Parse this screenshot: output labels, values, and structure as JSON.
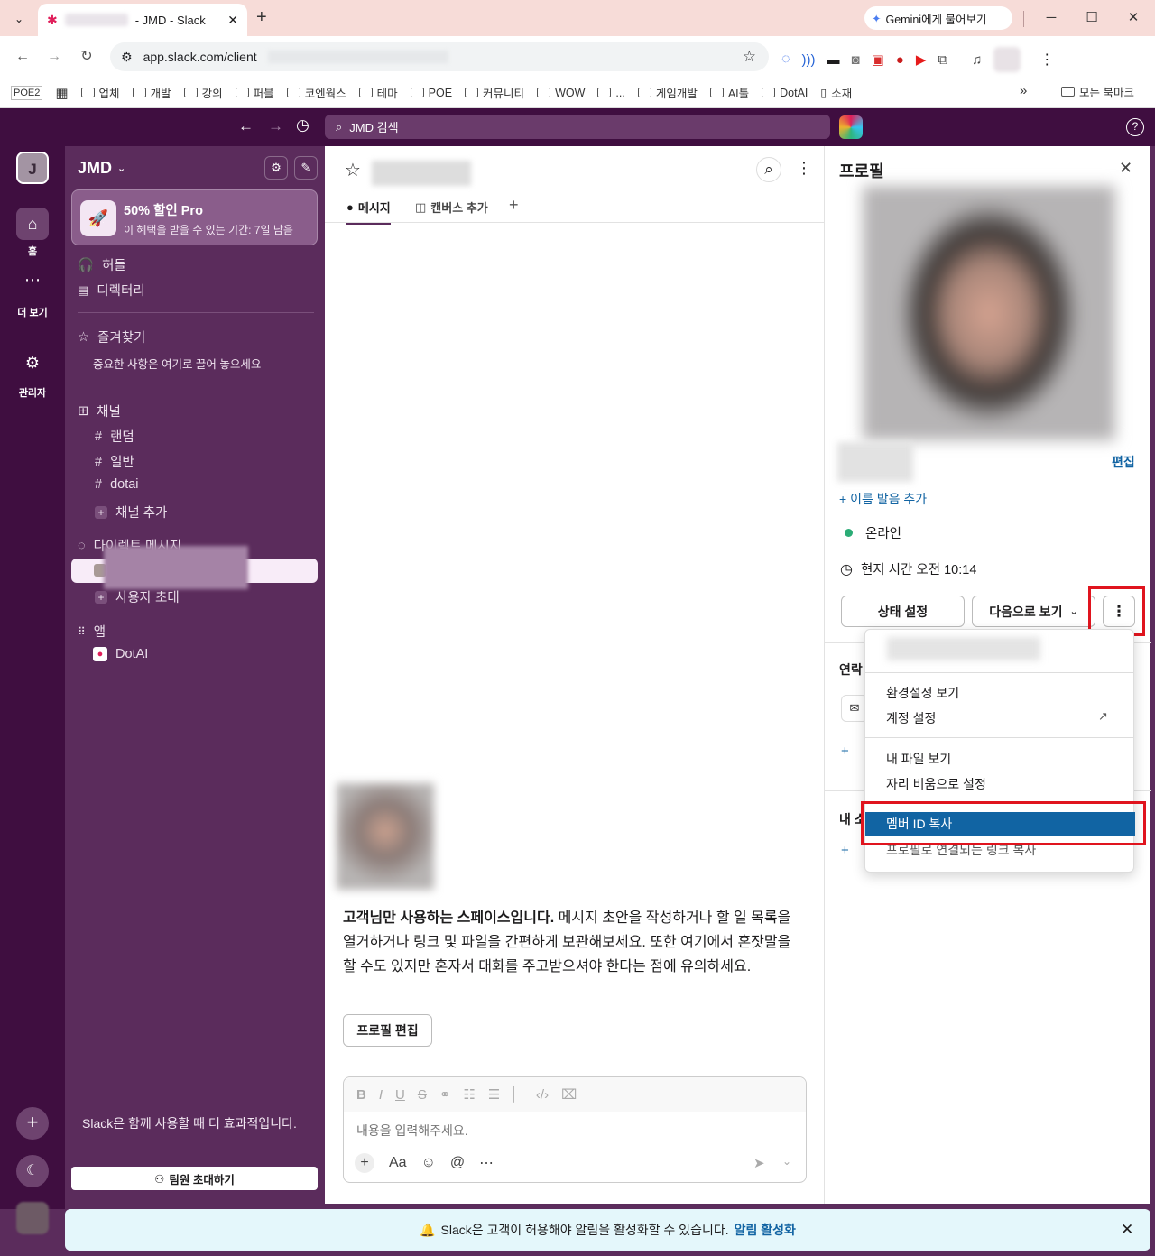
{
  "browser": {
    "tab_title": "- JMD - Slack",
    "new_tab": "+",
    "gemini_button": "Gemini에게 물어보기",
    "url": "app.slack.com/client",
    "bookmarks": [
      "POE2",
      "업체",
      "개발",
      "강의",
      "퍼블",
      "코엔웍스",
      "테마",
      "POE",
      "커뮤니티",
      "WOW",
      "...",
      "게임개발",
      "AI툴",
      "DotAI",
      "소재"
    ],
    "all_bookmarks": "모든 북마크",
    "more_bookmarks": "»"
  },
  "slack_top": {
    "search_placeholder": "JMD 검색"
  },
  "rail": {
    "workspace_initial": "J",
    "home_label": "홈",
    "more_label": "더 보기",
    "admin_label": "관리자"
  },
  "sidebar": {
    "workspace_name": "JMD",
    "promo_title": "50% 할인 Pro",
    "promo_sub": "이 혜택을 받을 수 있는 기간: 7일 남음",
    "huddle": "허들",
    "directory": "디렉터리",
    "favorites": "즐겨찾기",
    "favorites_hint": "중요한 사항은 여기로 끌어 놓으세요",
    "channels": "채널",
    "channel_list": [
      "랜덤",
      "일반",
      "dotai"
    ],
    "add_channel": "채널 추가",
    "dm_header": "다이렉트 메시지",
    "invite_user": "사용자 초대",
    "apps": "앱",
    "app_list": [
      "DotAI"
    ],
    "footer_text": "Slack은 함께 사용할 때 더 효과적입니다.",
    "invite_team_button": "팀원 초대하기"
  },
  "main": {
    "tab_messages": "메시지",
    "tab_canvas": "캔버스 추가",
    "intro_bold": "고객님만 사용하는 스페이스입니다.",
    "intro_text": " 메시지 초안을 작성하거나 할 일 목록을 열거하거나 링크 및 파일을 간편하게 보관해보세요. 또한 여기에서 혼잣말을 할 수도 있지만 혼자서 대화를 주고받으셔야 한다는 점에 유의하세요.",
    "edit_profile_button": "프로필 편집",
    "composer_placeholder": "내용을 입력해주세요.",
    "format_aa": "Aa"
  },
  "profile": {
    "title": "프로필",
    "edit_link": "편집",
    "add_pronunciation": "+ 이름 발음 추가",
    "status": "온라인",
    "local_time": "현지 시간 오전 10:14",
    "set_status_button": "상태 설정",
    "view_as_button": "다음으로 보기",
    "contact_header": "연락",
    "about_header": "내 소"
  },
  "menu": {
    "items": [
      "환경설정 보기",
      "계정 설정",
      "내 파일 보기",
      "자리 비움으로 설정",
      "멤버 ID 복사",
      "프로필로 연결되는 링크 복사"
    ]
  },
  "banner": {
    "text": "Slack은 고객이 허용해야 알림을 활성화할 수 있습니다.",
    "link": "알림 활성화"
  },
  "colors": {
    "aubergine": "#3f0e40",
    "sidebar": "#5b2c5c",
    "highlight": "#1164a3",
    "link": "#1264a3",
    "online": "#2bac76",
    "annotation": "#e0141e"
  }
}
